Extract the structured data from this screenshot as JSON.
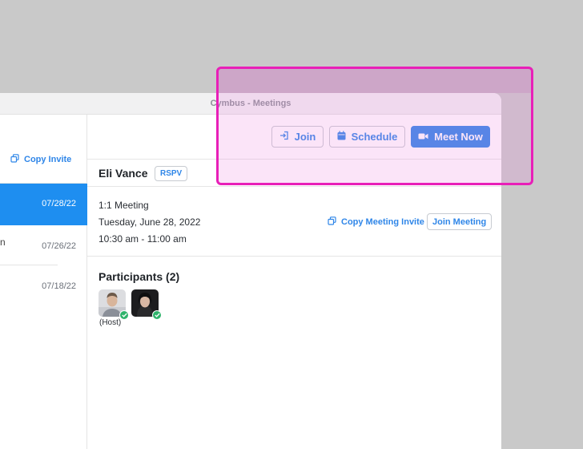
{
  "window": {
    "title": "Cymbus - Meetings"
  },
  "sidebar": {
    "copy_invite_label": "Copy Invite",
    "items": [
      {
        "date": "07/28/22",
        "selected": true
      },
      {
        "date": "07/26/22",
        "truncated_text": "n"
      },
      {
        "date": "07/18/22"
      }
    ]
  },
  "toolbar": {
    "join_label": "Join",
    "schedule_label": "Schedule",
    "meet_now_label": "Meet Now"
  },
  "meeting": {
    "host_name": "Eli Vance",
    "rspv_label": "RSPV",
    "type": "1:1 Meeting",
    "date": "Tuesday, June 28, 2022",
    "time": "10:30 am - 11:00 am",
    "copy_meeting_invite_label": "Copy Meeting Invite",
    "join_meeting_label": "Join Meeting"
  },
  "participants": {
    "title": "Participants (2)",
    "host_label": "(Host)"
  },
  "colors": {
    "accent": "#2f86e8",
    "selected_row": "#1e8ef0",
    "highlight_border": "#e81fb8",
    "status_check": "#2fb36b"
  }
}
